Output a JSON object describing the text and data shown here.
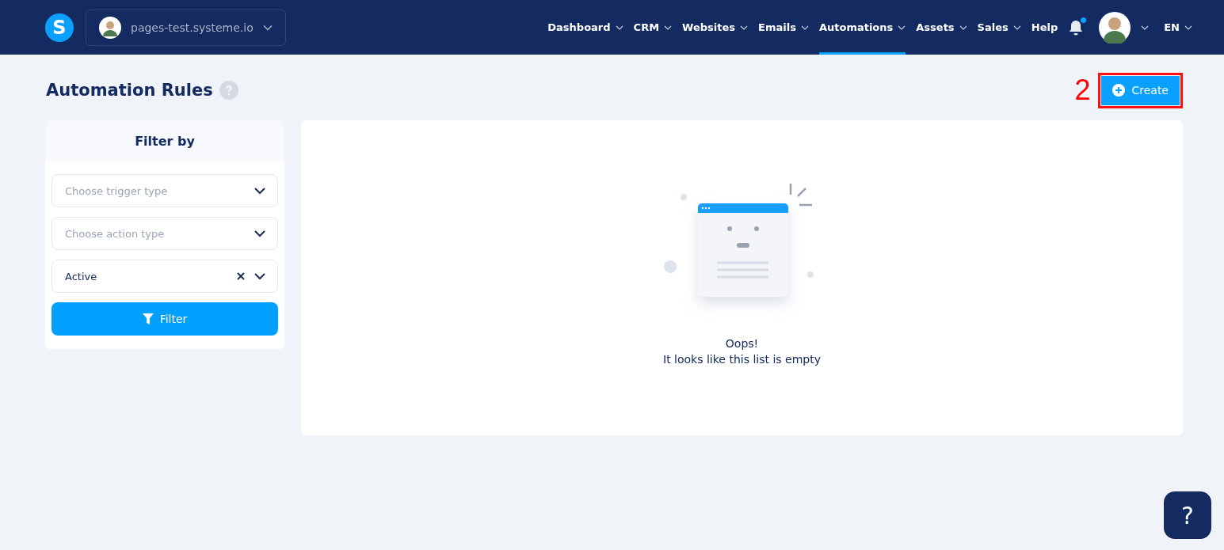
{
  "header": {
    "logo": "S",
    "site_selector": {
      "label": "pages-test.systeme.io"
    },
    "nav": [
      {
        "label": "Dashboard",
        "has_menu": true,
        "selected": false
      },
      {
        "label": "CRM",
        "has_menu": true,
        "selected": false
      },
      {
        "label": "Websites",
        "has_menu": true,
        "selected": false
      },
      {
        "label": "Emails",
        "has_menu": true,
        "selected": false
      },
      {
        "label": "Automations",
        "has_menu": true,
        "selected": true
      },
      {
        "label": "Assets",
        "has_menu": true,
        "selected": false
      },
      {
        "label": "Sales",
        "has_menu": true,
        "selected": false
      },
      {
        "label": "Help",
        "has_menu": false,
        "selected": false
      }
    ],
    "notifications": {
      "unread": true
    },
    "language": "EN"
  },
  "page": {
    "title": "Automation Rules",
    "create_button": "Create",
    "annotation": "2"
  },
  "filter": {
    "title": "Filter by",
    "fields": [
      {
        "placeholder": "Choose trigger type",
        "clearable": false
      },
      {
        "placeholder": "Choose action type",
        "clearable": false
      },
      {
        "value": "Active",
        "clearable": true
      }
    ],
    "button": "Filter"
  },
  "empty_state": {
    "title": "Oops!",
    "message": "It looks like this list is empty"
  },
  "help_widget": {
    "label": "?"
  }
}
